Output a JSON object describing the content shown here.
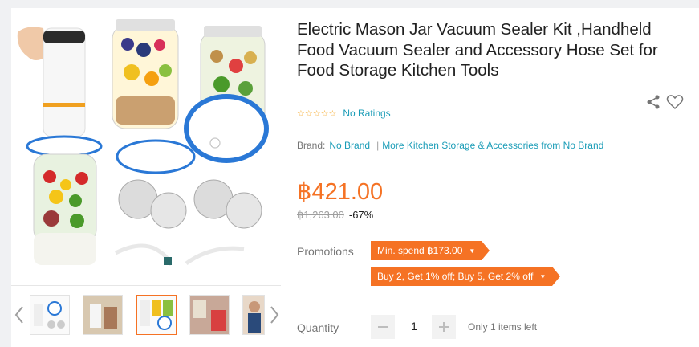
{
  "product": {
    "title": "Electric Mason Jar Vacuum Sealer Kit ,Handheld Food Vacuum Sealer and Accessory Hose Set for Food Storage Kitchen Tools",
    "stars": "☆☆☆☆☆",
    "ratings_label": "No Ratings",
    "brand_label": "Brand:",
    "brand_name": "No Brand",
    "separator": "|",
    "more_link": "More Kitchen Storage & Accessories from No Brand",
    "price": "฿421.00",
    "original_price": "฿1,263.00",
    "discount": "-67%"
  },
  "promotions": {
    "label": "Promotions",
    "items": [
      "Min. spend ฿173.00",
      "Buy 2, Get 1% off; Buy 5, Get 2% off"
    ]
  },
  "quantity": {
    "label": "Quantity",
    "value": "1",
    "stock_note": "Only 1 items left"
  },
  "icons": {
    "share": "share-icon",
    "wishlist": "heart-icon",
    "prev": "chevron-left-icon",
    "next": "chevron-right-icon",
    "minus": "minus-icon",
    "plus": "plus-icon"
  },
  "colors": {
    "accent": "#f57224",
    "link": "#1a9cb7"
  }
}
